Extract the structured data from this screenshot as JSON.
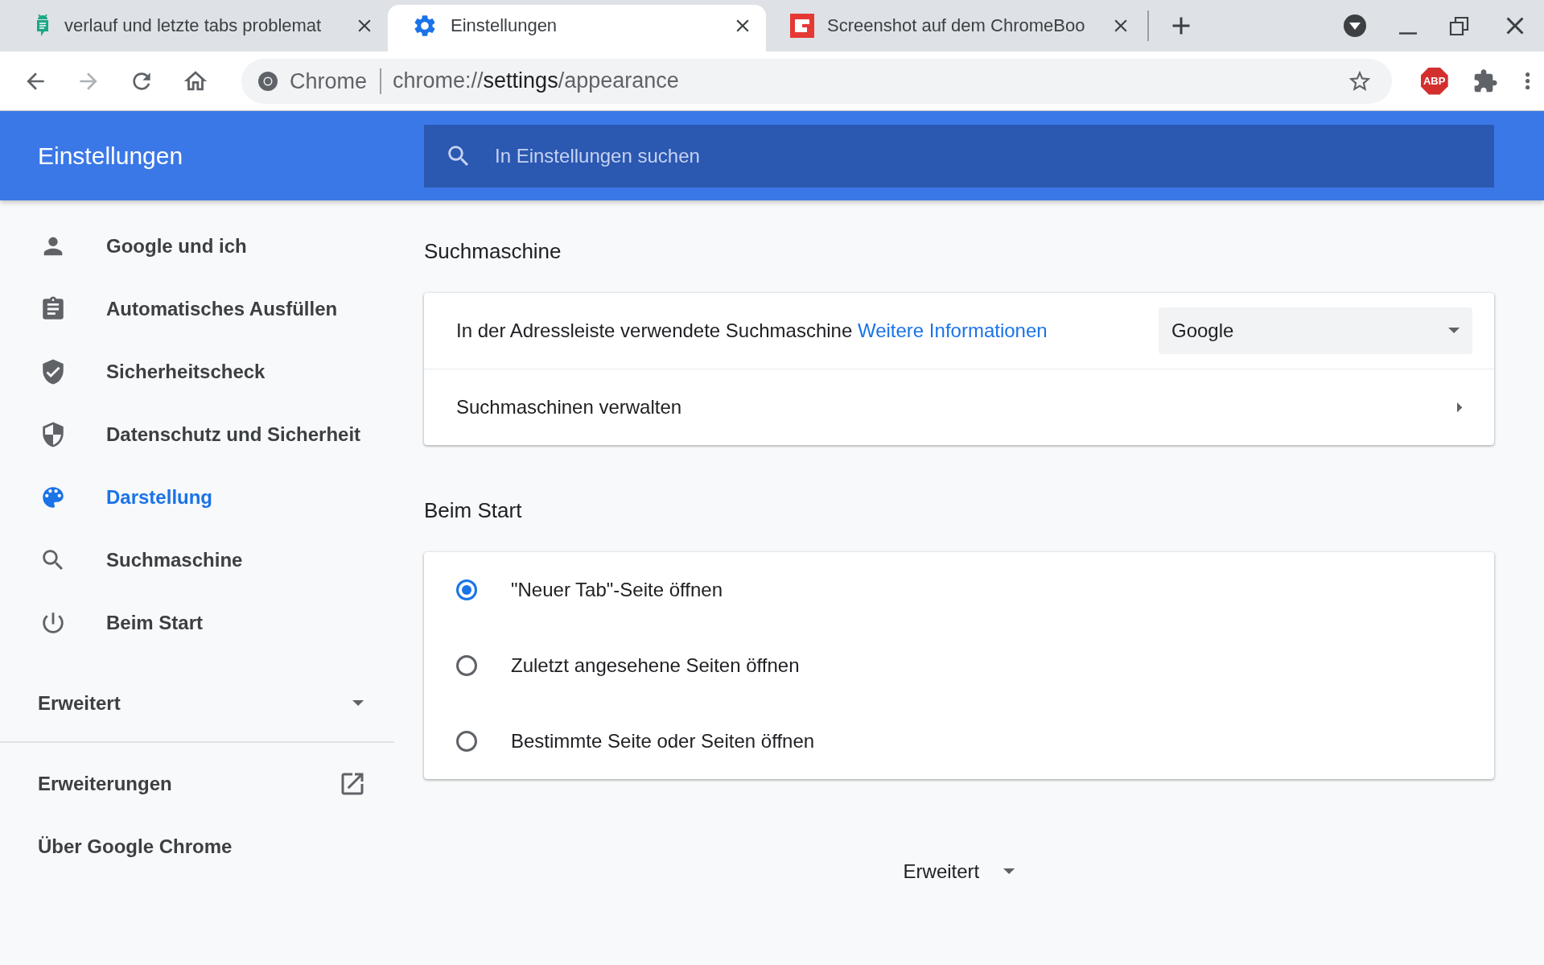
{
  "tabs": [
    {
      "kind": "forum",
      "title": "verlauf und letzte tabs problemat",
      "selected": false
    },
    {
      "kind": "settings",
      "title": "Einstellungen",
      "selected": true
    },
    {
      "kind": "app",
      "title": "Screenshot auf dem ChromeBoo",
      "selected": false
    }
  ],
  "toolbar": {
    "back": {
      "disabled": false
    },
    "forward": {
      "disabled": true
    },
    "site_label": "Chrome",
    "url": {
      "scheme": "chrome://",
      "host": "settings",
      "path": "/appearance"
    },
    "extension_label": "ABP"
  },
  "header": {
    "title": "Einstellungen",
    "search_placeholder": "In Einstellungen suchen"
  },
  "sidebar": {
    "items": [
      {
        "kind": "person",
        "label": "Google und ich",
        "selected": false
      },
      {
        "kind": "clipboard",
        "label": "Automatisches Ausfüllen",
        "selected": false
      },
      {
        "kind": "shield-check",
        "label": "Sicherheitscheck",
        "selected": false
      },
      {
        "kind": "shield",
        "label": "Datenschutz und Sicherheit",
        "selected": false
      },
      {
        "kind": "palette",
        "label": "Darstellung",
        "selected": true
      },
      {
        "kind": "search",
        "label": "Suchmaschine",
        "selected": false
      },
      {
        "kind": "power",
        "label": "Beim Start",
        "selected": false
      }
    ],
    "advanced": {
      "label": "Erweitert",
      "expanded": false
    },
    "links": [
      {
        "label": "Erweiterungen",
        "external": true
      },
      {
        "label": "Über Google Chrome",
        "external": false
      }
    ]
  },
  "sections": [
    {
      "title": "Suchmaschine",
      "rows": [
        {
          "kind": "select",
          "label": "In der Adressleiste verwendete Suchmaschine",
          "link": "Weitere Informationen",
          "value": "Google"
        },
        {
          "kind": "submenu",
          "label": "Suchmaschinen verwalten"
        }
      ]
    },
    {
      "title": "Beim Start",
      "rows": [
        {
          "kind": "radio",
          "label": "\"Neuer Tab\"-Seite öffnen",
          "selected": true
        },
        {
          "kind": "radio",
          "label": "Zuletzt angesehene Seiten öffnen",
          "selected": false
        },
        {
          "kind": "radio",
          "label": "Bestimmte Seite oder Seiten öffnen",
          "selected": false
        }
      ]
    }
  ],
  "footer": {
    "label": "Erweitert",
    "expanded": false
  }
}
